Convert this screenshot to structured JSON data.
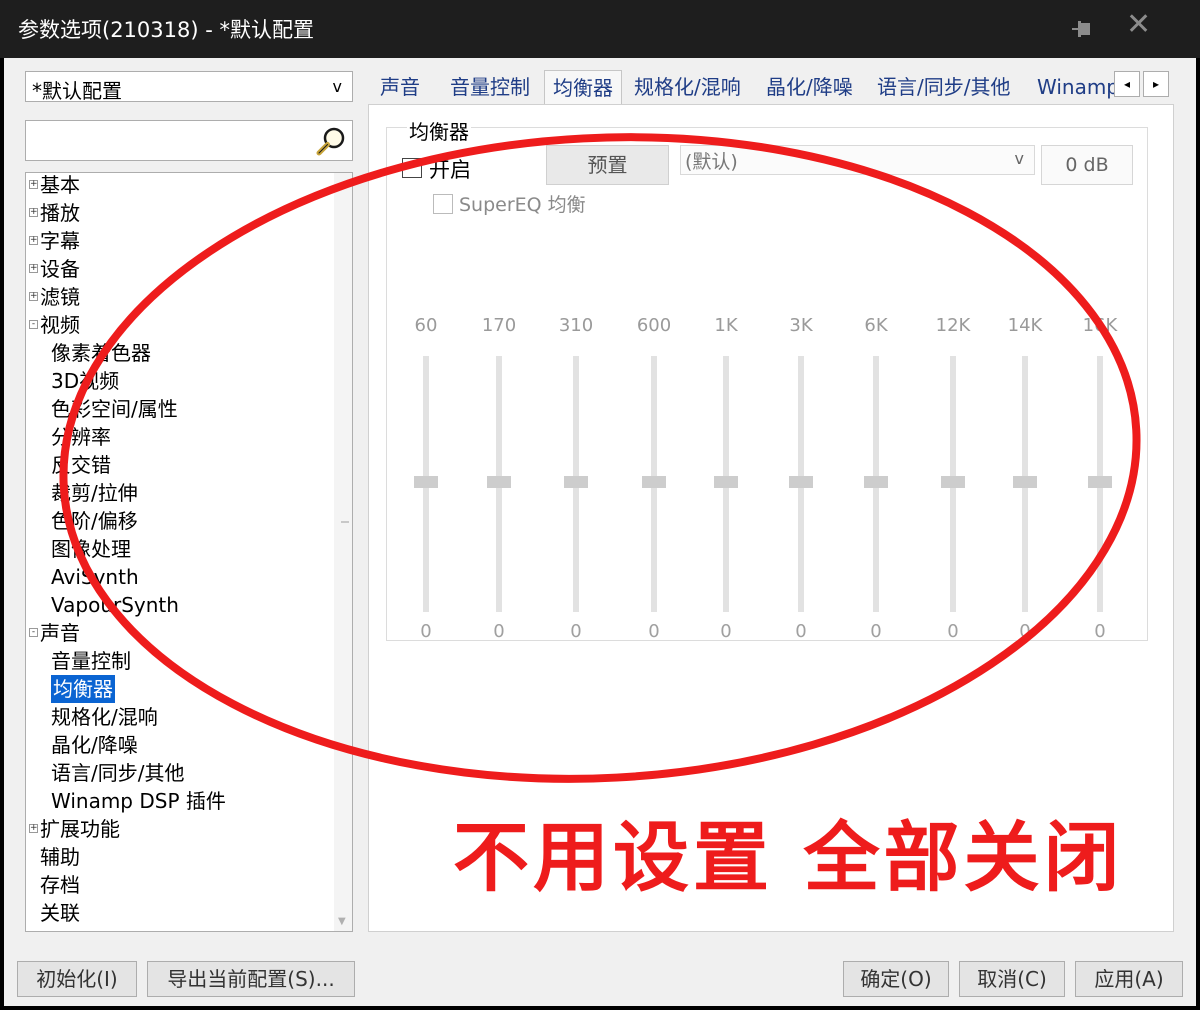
{
  "window": {
    "title": "参数选项(210318) - *默认配置"
  },
  "left": {
    "profile": "*默认配置",
    "profile_caret": "v",
    "tree": [
      {
        "label": "基本",
        "exp": "+",
        "indent": 0
      },
      {
        "label": "播放",
        "exp": "+",
        "indent": 0
      },
      {
        "label": "字幕",
        "exp": "+",
        "indent": 0
      },
      {
        "label": "设备",
        "exp": "+",
        "indent": 0
      },
      {
        "label": "滤镜",
        "exp": "+",
        "indent": 0
      },
      {
        "label": "视频",
        "exp": "-",
        "indent": 0
      },
      {
        "label": "像素着色器",
        "indent": 1
      },
      {
        "label": "3D视频",
        "indent": 1
      },
      {
        "label": "色彩空间/属性",
        "indent": 1
      },
      {
        "label": "分辨率",
        "indent": 1
      },
      {
        "label": "反交错",
        "indent": 1
      },
      {
        "label": "裁剪/拉伸",
        "indent": 1
      },
      {
        "label": "色阶/偏移",
        "indent": 1
      },
      {
        "label": "图像处理",
        "indent": 1
      },
      {
        "label": "AviSynth",
        "indent": 1
      },
      {
        "label": "VapourSynth",
        "indent": 1
      },
      {
        "label": "声音",
        "exp": "-",
        "indent": 0
      },
      {
        "label": "音量控制",
        "indent": 1
      },
      {
        "label": "均衡器",
        "indent": 1,
        "selected": true
      },
      {
        "label": "规格化/混响",
        "indent": 1
      },
      {
        "label": "晶化/降噪",
        "indent": 1
      },
      {
        "label": "语言/同步/其他",
        "indent": 1
      },
      {
        "label": "Winamp DSP 插件",
        "indent": 1
      },
      {
        "label": "扩展功能",
        "exp": "+",
        "indent": 0
      },
      {
        "label": "辅助",
        "indent": 0
      },
      {
        "label": "存档",
        "indent": 0
      },
      {
        "label": "关联",
        "indent": 0
      }
    ]
  },
  "tabs": [
    {
      "label": "声音"
    },
    {
      "label": "音量控制"
    },
    {
      "label": "均衡器",
      "active": true
    },
    {
      "label": "规格化/混响"
    },
    {
      "label": "晶化/降噪"
    },
    {
      "label": "语言/同步/其他"
    },
    {
      "label": "Winamp"
    }
  ],
  "tab_scroll": {
    "left": "◂",
    "right": "▸"
  },
  "equalizer": {
    "group_title": "均衡器",
    "enable_label": "开启",
    "enable_checked": false,
    "preset_button": "预置",
    "preset_value": "(默认)",
    "preset_caret": "v",
    "db_value": "0 dB",
    "supereq_label": "SuperEQ 均衡",
    "supereq_checked": false,
    "bands": [
      {
        "freq": "60",
        "value": "0"
      },
      {
        "freq": "170",
        "value": "0"
      },
      {
        "freq": "310",
        "value": "0"
      },
      {
        "freq": "600",
        "value": "0"
      },
      {
        "freq": "1K",
        "value": "0"
      },
      {
        "freq": "3K",
        "value": "0"
      },
      {
        "freq": "6K",
        "value": "0"
      },
      {
        "freq": "12K",
        "value": "0"
      },
      {
        "freq": "14K",
        "value": "0"
      },
      {
        "freq": "16K",
        "value": "0"
      }
    ]
  },
  "annotation": {
    "text": "不用设置 全部关闭",
    "color": "#ee1c1c"
  },
  "footer": {
    "init_button": "初始化(I)",
    "export_button": "导出当前配置(S)...",
    "ok_button": "确定(O)",
    "cancel_button": "取消(C)",
    "apply_button": "应用(A)"
  },
  "colors": {
    "accent": "#0a64d2",
    "tab_text": "#1f3d86",
    "annotation_red": "#ee1c1c"
  }
}
